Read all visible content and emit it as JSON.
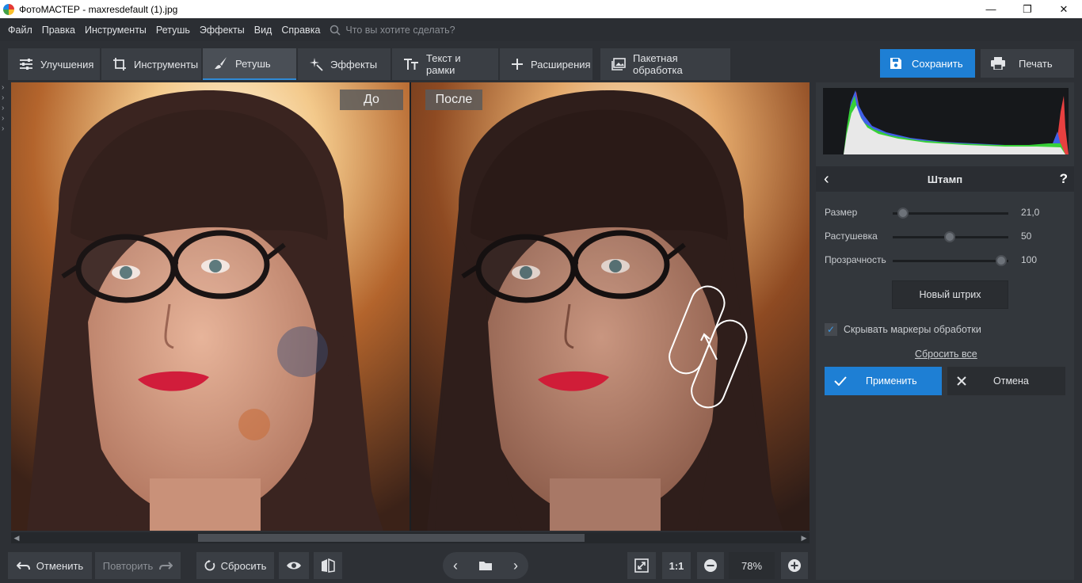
{
  "window": {
    "title": "ФотоМАСТЕР - maxresdefault (1).jpg",
    "minimize": "—",
    "maximize": "❐",
    "close": "✕"
  },
  "menu": {
    "items": [
      "Файл",
      "Правка",
      "Инструменты",
      "Ретушь",
      "Эффекты",
      "Вид",
      "Справка"
    ],
    "search_placeholder": "Что вы хотите сделать?"
  },
  "tabs": [
    {
      "label": "Улучшения",
      "icon": "sliders-icon"
    },
    {
      "label": "Инструменты",
      "icon": "crop-icon"
    },
    {
      "label": "Ретушь",
      "icon": "brush-icon",
      "active": true
    },
    {
      "label": "Эффекты",
      "icon": "sparkle-icon"
    },
    {
      "label": "Текст и рамки",
      "icon": "text-icon"
    },
    {
      "label": "Расширения",
      "icon": "plus-icon"
    },
    {
      "label": "Пакетная обработка",
      "icon": "images-icon"
    }
  ],
  "actions": {
    "save": "Сохранить",
    "print": "Печать"
  },
  "canvas": {
    "before_label": "До",
    "after_label": "После"
  },
  "bottom": {
    "undo": "Отменить",
    "redo": "Повторить",
    "reset": "Сбросить",
    "ratio": "1:1",
    "zoom": "78%"
  },
  "panel": {
    "title": "Штамп",
    "back": "‹",
    "help": "?",
    "sliders": [
      {
        "label": "Размер",
        "value": "21,0",
        "level": 0.1
      },
      {
        "label": "Растушевка",
        "value": "50",
        "level": 0.5
      },
      {
        "label": "Прозрачность",
        "value": "100",
        "level": 1.0
      }
    ],
    "new_stroke": "Новый штрих",
    "hide_markers": "Скрывать маркеры обработки",
    "hide_markers_checked": true,
    "reset_all": "Сбросить все",
    "apply": "Применить",
    "cancel": "Отмена"
  },
  "colors": {
    "accent": "#1e7fd4",
    "bg": "#2d3035",
    "panel": "#33373c"
  }
}
